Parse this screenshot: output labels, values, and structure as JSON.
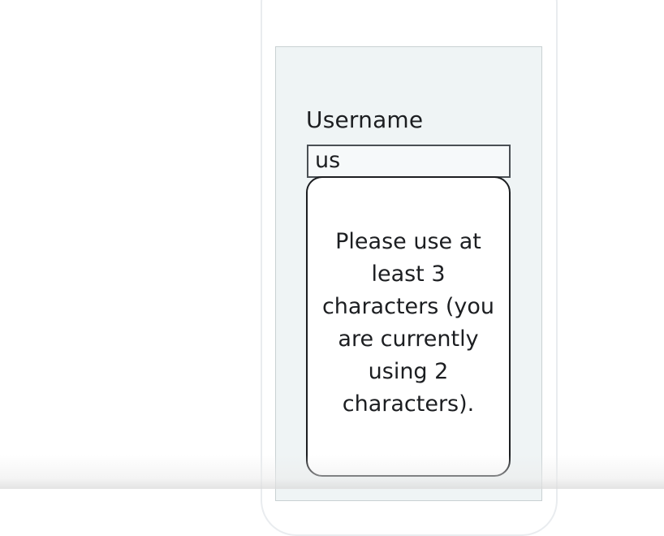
{
  "form": {
    "username_label": "Username",
    "username_value": "us"
  },
  "validation_tooltip": {
    "message": "Please use at least 3 characters (you are currently using 2 characters)."
  },
  "colors": {
    "screen_background": "#eff4f5",
    "input_border": "#4a4f54",
    "tooltip_border": "#1c1e21"
  }
}
